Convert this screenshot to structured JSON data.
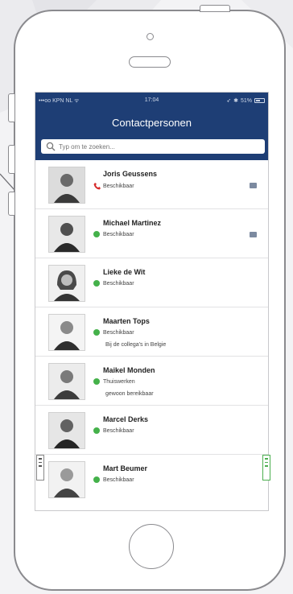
{
  "statusbar": {
    "carrier": "•••oo KPN NL ᯤ",
    "time": "17:04",
    "battery": "51%"
  },
  "header": {
    "title": "Contactpersonen"
  },
  "search": {
    "placeholder": "Typ om te zoeken..."
  },
  "contacts": [
    {
      "name": "Joris Geussens",
      "status": "Beschikbaar",
      "indicator": "on-call",
      "note": "",
      "has_chat": true
    },
    {
      "name": "Michael Martinez",
      "status": "Beschikbaar",
      "indicator": "available",
      "note": "",
      "has_chat": true
    },
    {
      "name": "Lieke de Wit",
      "status": "Beschikbaar",
      "indicator": "available",
      "note": "",
      "has_chat": false
    },
    {
      "name": "Maarten Tops",
      "status": "Beschikbaar",
      "indicator": "available",
      "note": "Bij de collega's in Belgie",
      "has_chat": false
    },
    {
      "name": "Maikel Monden",
      "status": "Thuiswerken",
      "indicator": "available",
      "note": "gewoon bereikbaar",
      "has_chat": false
    },
    {
      "name": "Marcel Derks",
      "status": "Beschikbaar",
      "indicator": "available",
      "note": "",
      "has_chat": false
    },
    {
      "name": "Mart Beumer",
      "status": "Beschikbaar",
      "indicator": "available",
      "note": "",
      "has_chat": false
    }
  ],
  "colors": {
    "header": "#1e3e75",
    "available": "#44b14a",
    "on_call": "#d62b2b",
    "chat": "#7c8aa0"
  },
  "icons": {
    "search": "magnifier-icon",
    "call": "phone-handset-icon",
    "chat": "chat-bubble-icon"
  }
}
